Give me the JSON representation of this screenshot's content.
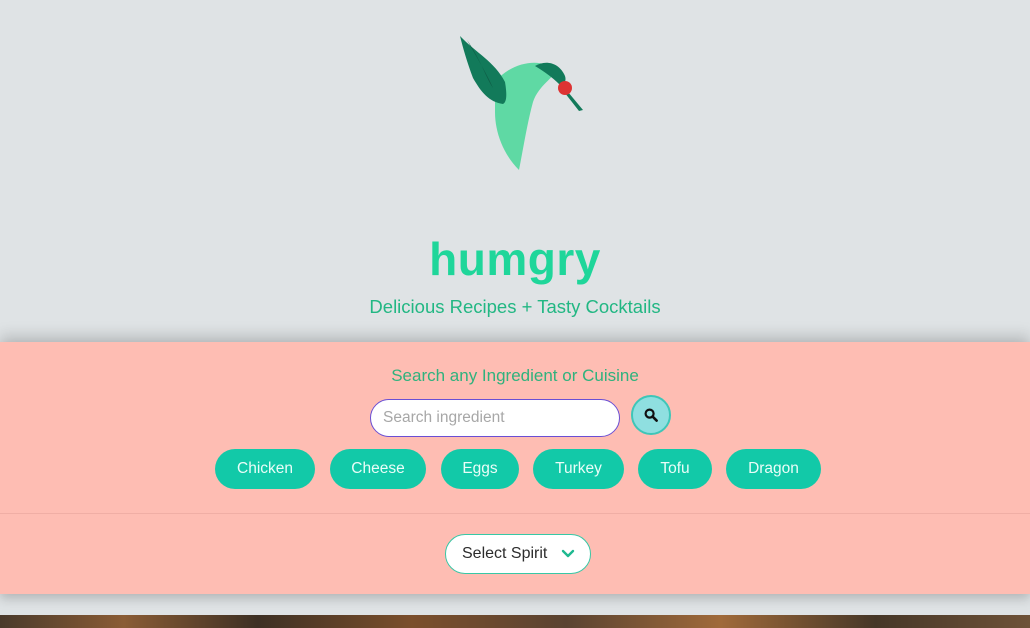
{
  "brand": {
    "name": "humgry",
    "tagline": "Delicious Recipes + Tasty Cocktails",
    "logo_icon": "hummingbird-logo",
    "colors": {
      "primary": "#1fd69a",
      "accent_red": "#dd3333",
      "dark_green": "#127a5a"
    }
  },
  "search": {
    "heading": "Search any Ingredient or Cuisine",
    "placeholder": "Search ingredient",
    "value": "",
    "button_icon": "search-icon"
  },
  "chips": [
    {
      "label": "Chicken"
    },
    {
      "label": "Cheese"
    },
    {
      "label": "Eggs"
    },
    {
      "label": "Turkey"
    },
    {
      "label": "Tofu"
    },
    {
      "label": "Dragon"
    }
  ],
  "spirit_select": {
    "selected": "Select Spirit",
    "icon": "chevron-down-icon"
  },
  "theme": {
    "page_bg": "#dfe3e5",
    "panel_bg": "#febdb3",
    "chip_bg": "#12c9a8"
  }
}
